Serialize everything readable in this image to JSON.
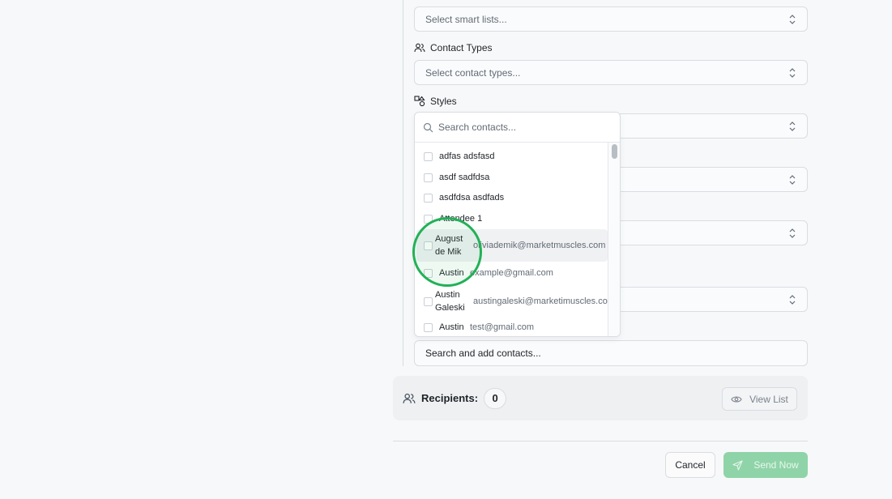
{
  "smart_lists": {
    "placeholder": "Select smart lists..."
  },
  "contact_types": {
    "label": "Contact Types",
    "placeholder": "Select contact types..."
  },
  "styles": {
    "label": "Styles"
  },
  "contact_search": {
    "placeholder": "Search contacts..."
  },
  "contacts": [
    {
      "name": "adfas adsfasd",
      "email": ""
    },
    {
      "name": "asdf sadfdsa",
      "email": ""
    },
    {
      "name": "asdfdsa asdfads",
      "email": ""
    },
    {
      "name": "Attendee 1",
      "email": ""
    },
    {
      "name_line1": "August",
      "name_line2": "de Mik",
      "email": "oliviademik@marketmuscles.com"
    },
    {
      "name": "Austin",
      "email": "example@gmail.com"
    },
    {
      "name_line1": "Austin",
      "name_line2": "Galeski",
      "email": "austingaleski@marketimuscles.com"
    },
    {
      "name": "Austin",
      "email": "test@gmail.com"
    }
  ],
  "add_contacts": {
    "placeholder": "Search and add contacts..."
  },
  "recipients": {
    "label": "Recipients:",
    "count": "0",
    "view_list_label": "View List"
  },
  "footer": {
    "cancel_label": "Cancel",
    "send_label": "Send Now"
  },
  "colors": {
    "accent": "#22b157",
    "send_button": "#8fd4a8"
  },
  "icons": [
    "users-icon",
    "shapes-icon",
    "search-icon",
    "chevrons-up-down-icon",
    "eye-icon",
    "send-icon"
  ]
}
